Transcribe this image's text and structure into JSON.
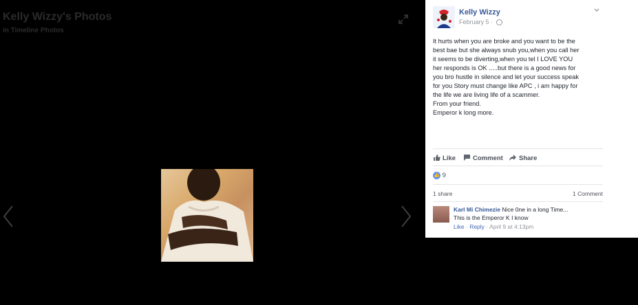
{
  "viewer": {
    "album_title": "Kelly Wizzy's Photos",
    "album_sub": "in Timeline Photos",
    "icons": {
      "expand": "expand-icon",
      "prev": "chevron-left-icon",
      "next": "chevron-right-icon"
    }
  },
  "post": {
    "author": "Kelly Wizzy",
    "date": "February 5",
    "separator": "·",
    "text_lines": [
      "It hurts when you are broke and you want to be the",
      "best bae but she always snub you,when you call her",
      "it seems to be diverting,when you tel I LOVE YOU",
      "her responds is OK .....but there is a good news for",
      "you bro hustle in silence and let your success speak",
      "for you Story must change like APC , i am happy for",
      "the life we are living life of a scammer.",
      "From your friend.",
      "Emperor k long more."
    ]
  },
  "actions": {
    "like": "Like",
    "comment": "Comment",
    "share": "Share"
  },
  "reactions": {
    "count": "9"
  },
  "stats": {
    "shares": "1 share",
    "comments": "1 Comment"
  },
  "comment": {
    "author": "Karl Mi Chimezie",
    "text1": "Nice 0ne in a long Time...",
    "text2": "This is the Emperor K I know",
    "like": "Like",
    "reply": "Reply",
    "sep": "·",
    "time": "April 9 at 4:13pm"
  },
  "colors": {
    "link": "#365899",
    "accent": "#4267b2",
    "badge": "#5890ff"
  }
}
